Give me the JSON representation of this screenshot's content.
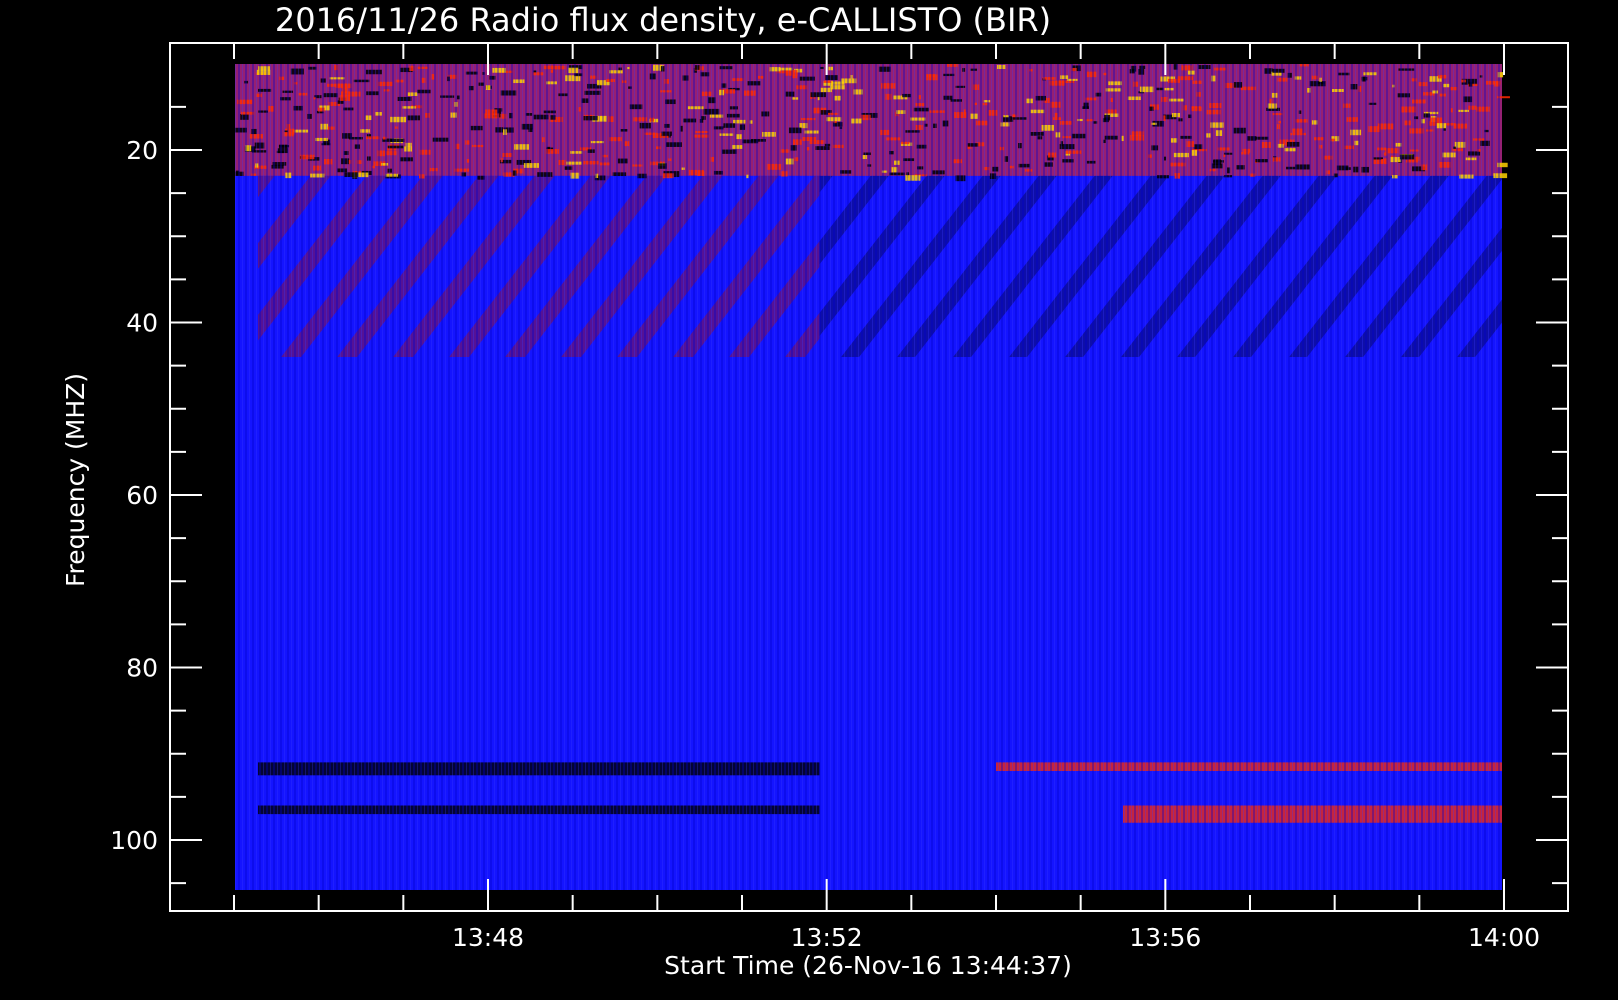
{
  "chart_data": {
    "type": "heatmap",
    "title": "2016/11/26  Radio flux density, e-CALLISTO (BIR)",
    "xlabel": "Start Time (26-Nov-16 13:44:37)",
    "ylabel": "Frequency (MHZ)",
    "y_ticks": [
      "20",
      "40",
      "60",
      "80",
      "100"
    ],
    "x_ticks": [
      "13:48",
      "13:52",
      "13:56",
      "14:00"
    ],
    "y_range_mhz": [
      10,
      107
    ],
    "x_range": [
      "13:44:37",
      "14:00"
    ],
    "colormap": {
      "low": "#000000",
      "mid": "#1414ff",
      "high": "#ff2a00",
      "peak": "#ffd200"
    },
    "bands": [
      {
        "name": "rfi-hot-top",
        "freq_mhz": [
          10,
          23
        ],
        "level": "high"
      },
      {
        "name": "background-left",
        "freq_mhz": [
          23,
          106
        ],
        "time": [
          "13:45:17",
          "13:51:55"
        ],
        "level": "mid"
      },
      {
        "name": "diagonal-stripes-left",
        "freq_mhz": [
          23,
          44
        ],
        "time": [
          "13:45:17",
          "13:51:55"
        ],
        "level": "mid-high"
      },
      {
        "name": "diagonal-stripes-right",
        "freq_mhz": [
          23,
          44
        ],
        "time": [
          "13:51:55",
          "14:00"
        ],
        "level": "mid-low"
      },
      {
        "name": "dark-band-left-1",
        "freq_mhz": [
          91,
          92.5
        ],
        "time": [
          "13:45:17",
          "13:51:55"
        ],
        "level": "low"
      },
      {
        "name": "dark-band-left-2",
        "freq_mhz": [
          96,
          97
        ],
        "time": [
          "13:45:17",
          "13:51:55"
        ],
        "level": "low"
      },
      {
        "name": "hot-band-right-1",
        "freq_mhz": [
          91,
          92
        ],
        "time": [
          "13:54",
          "14:00"
        ],
        "level": "high"
      },
      {
        "name": "hot-band-right-2",
        "freq_mhz": [
          96,
          98
        ],
        "time": [
          "13:55:30",
          "14:00"
        ],
        "level": "high"
      }
    ]
  }
}
